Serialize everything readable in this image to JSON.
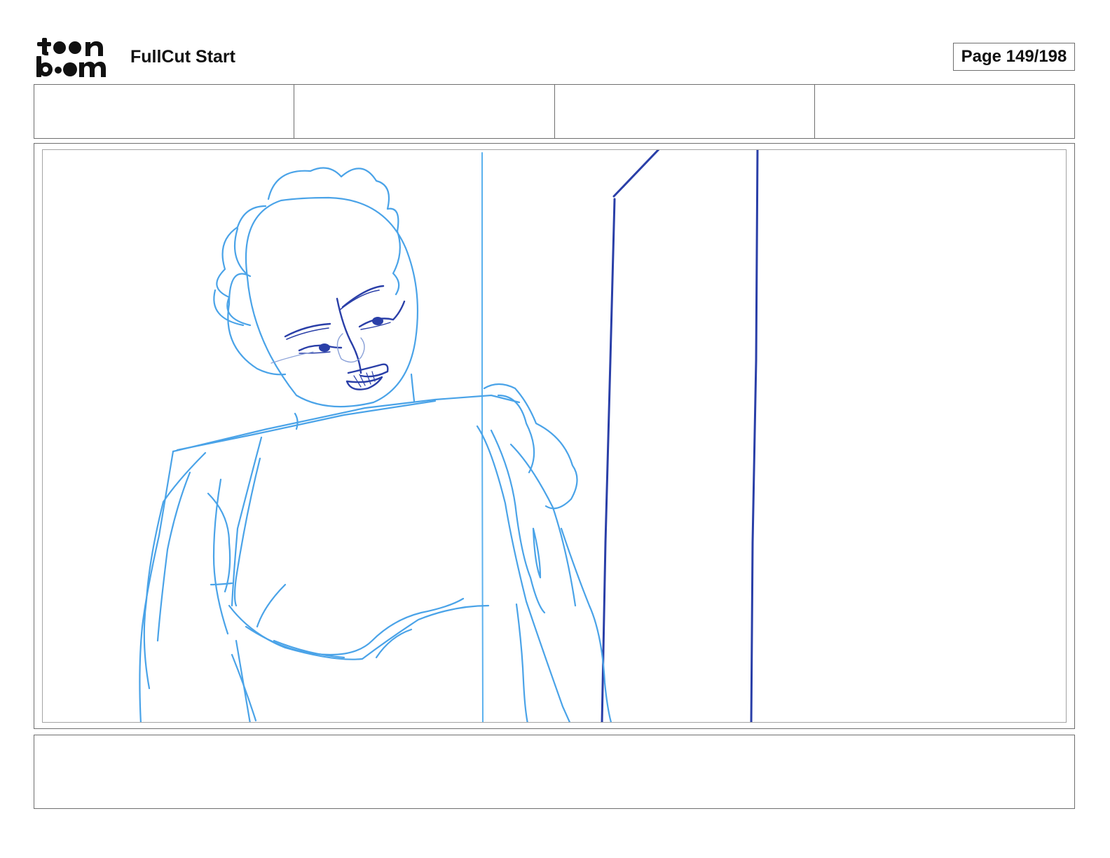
{
  "header": {
    "logo_text": "toon boom",
    "project_title": "FullCut Start",
    "page_label": "Page 149/198"
  },
  "info_row": {
    "cells": [
      "",
      "",
      "",
      ""
    ]
  },
  "panel": {
    "sketch_colors": {
      "rough_lines": "#4aa3e8",
      "construction_lines": "#5bb1ee",
      "clean_lines": "#2a3fa8"
    }
  },
  "dialogue": {
    "text": ""
  }
}
